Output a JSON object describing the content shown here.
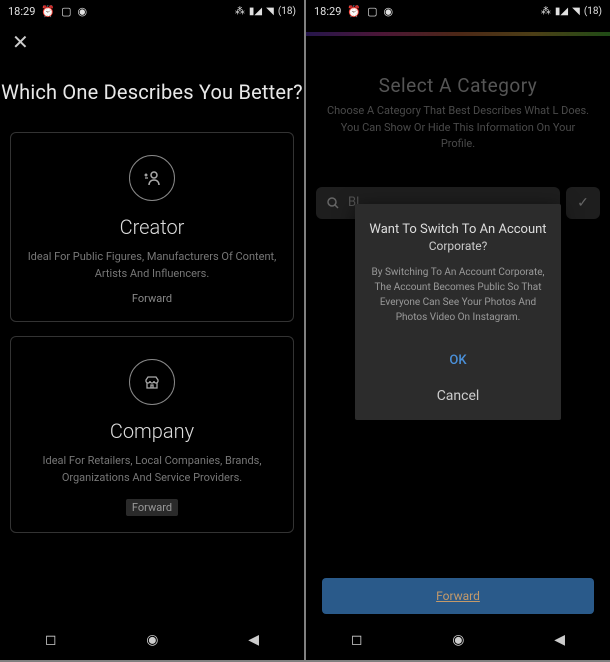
{
  "status": {
    "time": "18:29",
    "battery": "18"
  },
  "screen1": {
    "title": "Which One Describes You Better?",
    "cards": [
      {
        "title": "Creator",
        "desc": "Ideal For Public Figures, Manufacturers Of Content, Artists And Influencers.",
        "forward": "Forward"
      },
      {
        "title": "Company",
        "desc": "Ideal For Retailers, Local Companies, Brands, Organizations And Service Providers.",
        "forward": "Forward"
      }
    ]
  },
  "screen2": {
    "title": "Select A Category",
    "sub": "Choose A Category That Best Describes What L Does. You Can Show Or Hide This Information On Your Profile.",
    "search_placeholder": "Bl",
    "dialog": {
      "title": "Want To Switch To An Account",
      "sub": "Corporate?",
      "body": "By Switching To An Account Corporate, The Account Becomes Public So That Everyone Can See Your Photos And Photos Video On Instagram.",
      "ok": "OK",
      "cancel": "Cancel"
    },
    "forward": "Forward"
  }
}
